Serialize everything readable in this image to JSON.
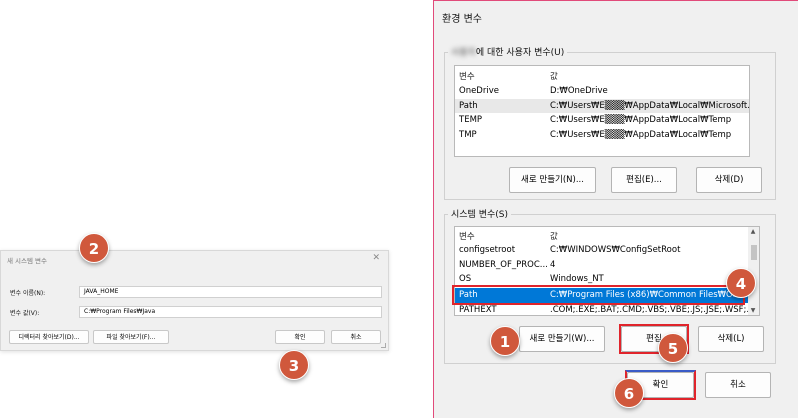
{
  "new_var_dialog": {
    "title": "새 시스템 변수",
    "close_glyph": "✕",
    "name_label": "변수 이름(N):",
    "name_value": "JAVA_HOME",
    "value_label": "변수 값(V):",
    "value_value": "C:₩Program Files₩Java",
    "browse_dir_label": "디렉터리 찾아보기(D)...",
    "browse_file_label": "파일 찾아보기(F)...",
    "ok_label": "확인",
    "cancel_label": "취소"
  },
  "env_dialog": {
    "title": "환경 변수",
    "user_group_label": "에 대한 사용자 변수(U)",
    "user_group_prefix_blur": "사용자",
    "col_var": "변수",
    "col_val": "값",
    "user_vars": [
      {
        "name": "OneDrive",
        "value": "D:₩OneDrive"
      },
      {
        "name": "Path",
        "value": "C:₩Users₩E▒▒▒₩AppData₩Local₩Microsoft..."
      },
      {
        "name": "TEMP",
        "value": "C:₩Users₩E▒▒▒₩AppData₩Local₩Temp"
      },
      {
        "name": "TMP",
        "value": "C:₩Users₩E▒▒▒₩AppData₩Local₩Temp"
      }
    ],
    "user_new_label": "새로 만들기(N)...",
    "user_edit_label": "편집(E)...",
    "user_delete_label": "삭제(D)",
    "system_group_label": "시스템 변수(S)",
    "system_vars": [
      {
        "name": "configsetroot",
        "value": "C:₩WINDOWS₩ConfigSetRoot"
      },
      {
        "name": "NUMBER_OF_PROC...",
        "value": "4"
      },
      {
        "name": "OS",
        "value": "Windows_NT"
      },
      {
        "name": "Path",
        "value": "C:₩Program Files (x86)₩Common Files₩Or..."
      },
      {
        "name": "PATHEXT",
        "value": ".COM;.EXE;.BAT;.CMD;.VBS;.VBE;.JS;.JSE;.WSF;..."
      }
    ],
    "system_new_label": "새로 만들기(W)...",
    "system_edit_label": "편집",
    "system_delete_label": "삭제(L)",
    "ok_label": "확인",
    "cancel_label": "취소",
    "scroll_up": "▲",
    "scroll_down": "▼"
  },
  "step_badges": [
    "1",
    "2",
    "3",
    "4",
    "5",
    "6"
  ],
  "colors": {
    "badge": "#d0583c",
    "highlight_box": "#e0242b",
    "selection": "#0078d7",
    "window_border": "#e14a7a"
  }
}
